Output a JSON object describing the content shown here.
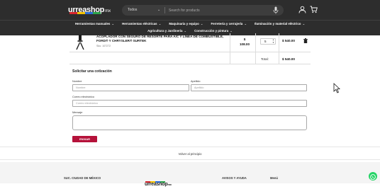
{
  "header": {
    "logo": "urreashop",
    "logo_suffix": "mx",
    "search": {
      "category": "Todos",
      "placeholder": "Search for products"
    },
    "icons": [
      "user-icon",
      "cart-icon",
      "mic-icon",
      "chevron-down-icon"
    ]
  },
  "nav": {
    "row1": [
      "Herramientas manuales",
      "Herramientas eléctricas",
      "Maquinaria y equipo",
      "Ferretería y cerrajería",
      "Iluminación y material eléctrico"
    ],
    "row2": [
      "Agricultura y Jardinería",
      "Construcción y pintura"
    ]
  },
  "cart": {
    "product_name": "ACOPLADOR CON SEGURO DE RESORTE PARA A/C Y LÍNEA DE COMBUSTIBLE, FORD® Y CHRYSLER® SURTEK",
    "sku": "Sku: 107272",
    "unit_price_symbol": "$",
    "unit_price_value": "108.00",
    "quantity": "5",
    "line_total": "$ 540.00",
    "total_label": "Total:",
    "total_value": "$ 540.00"
  },
  "form": {
    "title": "Solicitar una cotización",
    "nombre_label": "Nombre",
    "nombre_placeholder": "Nombre",
    "apellido_label": "Apellido",
    "apellido_placeholder": "Apellido",
    "email_label": "Correo electrónico",
    "email_placeholder": "Correo electrónico",
    "mensaje_label": "Mensaje",
    "submit_label": "ENVIAR"
  },
  "back_to_top": "Volver al principio",
  "footer": {
    "col1": "SUC. CIUDAD DE MÉXICO",
    "logo": "urreashop",
    "logo_suffix": "mx",
    "col3": "AVISOS Y AYUDA",
    "col4": "Menú"
  },
  "colors": {
    "header_bg": "#2d2d2d",
    "accent": "#b5123a",
    "stripe_red": "#d7262e",
    "stripe_yellow": "#f3c200",
    "stripe_blue": "#2a6bd6",
    "stripe_green": "#2ca44a",
    "whatsapp": "#25d366"
  }
}
